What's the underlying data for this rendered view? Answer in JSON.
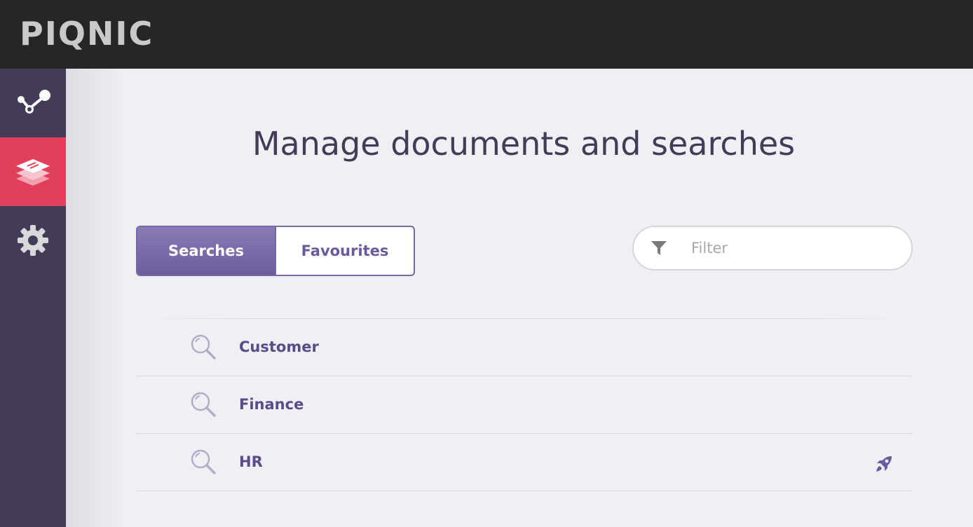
{
  "app": {
    "logo_text": "PIQNIC",
    "colors": {
      "topbar": "#262629",
      "sidebar": "#433b58",
      "sidebar_active": "#e23f5a",
      "accent": "#7867a6",
      "background": "#eff0f4"
    }
  },
  "sidebar": {
    "items": [
      {
        "icon": "graph-nodes-icon",
        "active": false
      },
      {
        "icon": "layers-icon",
        "active": true
      },
      {
        "icon": "gear-icon",
        "active": false
      }
    ]
  },
  "main": {
    "title": "Manage documents and searches",
    "tabs": [
      {
        "label": "Searches",
        "active": true
      },
      {
        "label": "Favourites",
        "active": false
      }
    ],
    "filter": {
      "placeholder": "Filter",
      "value": "",
      "icon": "funnel-icon"
    },
    "searches": [
      {
        "label": "Customer",
        "icon": "search-icon",
        "badge": null
      },
      {
        "label": "Finance",
        "icon": "search-icon",
        "badge": null
      },
      {
        "label": "HR",
        "icon": "search-icon",
        "badge": "rocket-icon"
      }
    ]
  }
}
